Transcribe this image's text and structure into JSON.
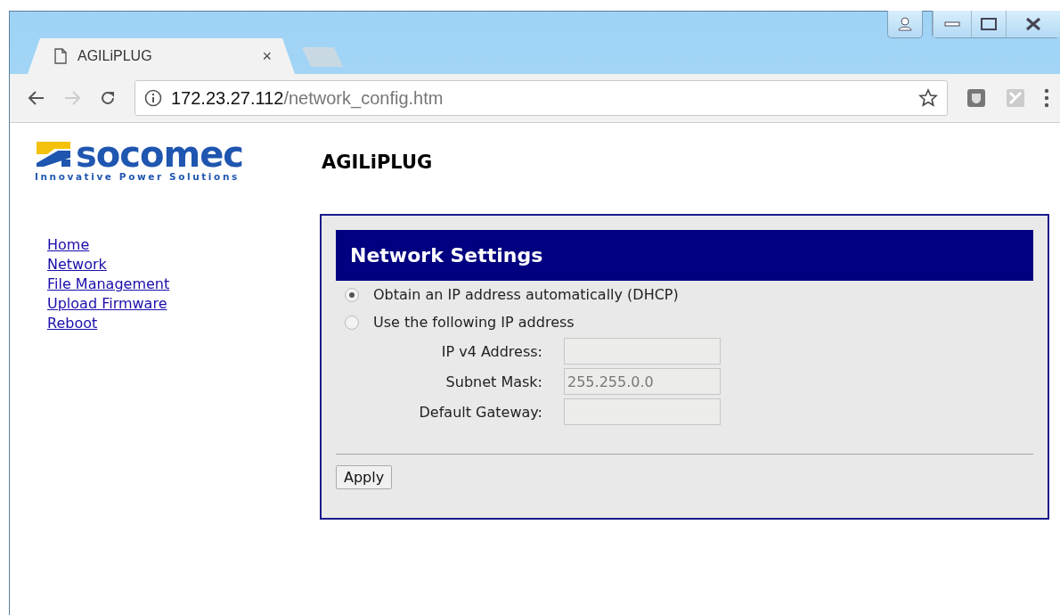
{
  "browser": {
    "tab": {
      "title": "AGILiPLUG",
      "close": "×"
    },
    "address": {
      "host": "172.23.27.112",
      "path": "/network_config.htm"
    }
  },
  "page": {
    "logo": {
      "name": "socomec",
      "tagline": "Innovative Power Solutions"
    },
    "title": "AGILiPLUG",
    "nav": [
      "Home",
      "Network",
      "File Management",
      "Upload Firmware",
      "Reboot"
    ],
    "panel": {
      "heading": "Network Settings",
      "options": [
        {
          "label": "Obtain an IP address automatically (DHCP)",
          "selected": true
        },
        {
          "label": "Use the following IP address",
          "selected": false
        }
      ],
      "fields": [
        {
          "label": "IP v4 Address:",
          "disabled": true
        },
        {
          "label": "Subnet Mask:",
          "value": "255.255.0.0",
          "disabled": true
        },
        {
          "label": "Default Gateway:",
          "disabled": true
        }
      ],
      "button": "Apply"
    }
  }
}
